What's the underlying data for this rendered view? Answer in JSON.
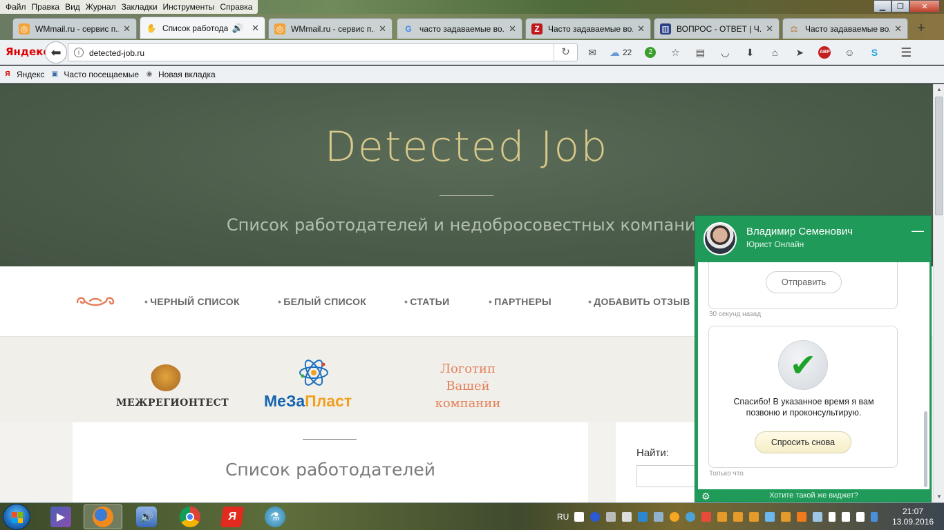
{
  "menubar": {
    "items": [
      "Файл",
      "Правка",
      "Вид",
      "Журнал",
      "Закладки",
      "Инструменты",
      "Справка"
    ]
  },
  "tabs": [
    {
      "title": "WMmail.ru - сервис п...",
      "icon": "wmmail-icon"
    },
    {
      "title": "Список работода...",
      "icon": "hand-icon",
      "active": true
    },
    {
      "title": "WMmail.ru - сервис п...",
      "icon": "wmmail-icon"
    },
    {
      "title": "часто задаваемые во...",
      "icon": "google-icon"
    },
    {
      "title": "Часто задаваемые во...",
      "icon": "red-z-icon"
    },
    {
      "title": "ВОПРОС - ОТВЕТ | Ч...",
      "icon": "building-icon"
    },
    {
      "title": "Часто задаваемые во...",
      "icon": "scales-icon"
    }
  ],
  "nav": {
    "brand": "Яндекс",
    "url": "detected-job.ru",
    "weather_temp": "22",
    "badge_count": "2",
    "adblock": "ABP"
  },
  "bookmarks": [
    "Яндекс",
    "Часто посещаемые",
    "Новая вкладка"
  ],
  "site": {
    "title": "Detected Job",
    "subtitle": "Список работодателей и недобросовестных компаний",
    "menu": [
      "ЧЕРНЫЙ СПИСОК",
      "БЕЛЫЙ СПИСОК",
      "СТАТЬИ",
      "ПАРТНЕРЫ",
      "ДОБАВИТЬ ОТЗЫВ"
    ],
    "logos": {
      "mezh": "МЕЖРЕГИОНТЕСТ",
      "meza_part1": "МеЗа",
      "meza_part2": "Пласт",
      "yours_line1": "Логотип",
      "yours_line2": "Вашей",
      "yours_line3": "компании"
    },
    "section_title": "Список работодателей",
    "search_label": "Найти:"
  },
  "widget": {
    "name": "Владимир Семенович",
    "role": "Юрист Онлайн",
    "send_label": "Отправить",
    "time1": "30 секунд назад",
    "thanks": "Спасибо! В указанное время я вам позвоню и проконсультирую.",
    "ask_again": "Спросить снова",
    "time2": "Только что",
    "footer_link": "Хотите такой же виджет?"
  },
  "taskbar": {
    "lang": "RU",
    "time": "21:07",
    "date": "13.09.2016"
  },
  "colors": {
    "hero_bg": "#4b5b49",
    "hero_title": "#d9c98a",
    "widget_green": "#1f9a58",
    "accent_orange": "#e3805c"
  }
}
